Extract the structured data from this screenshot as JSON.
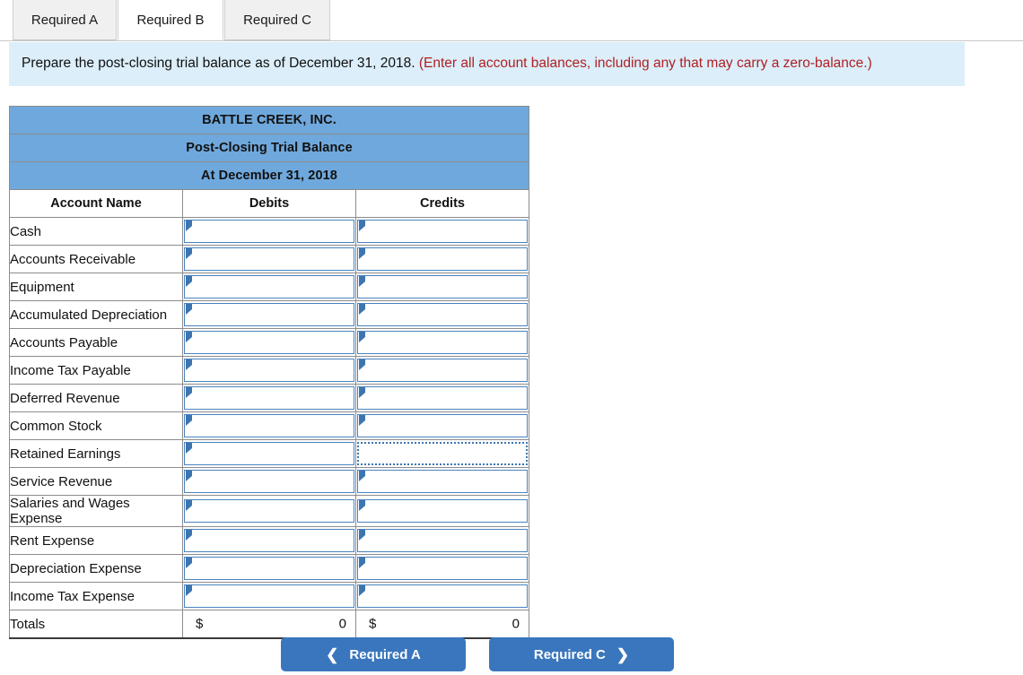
{
  "tabs": [
    {
      "label": "Required A",
      "active": false
    },
    {
      "label": "Required B",
      "active": true
    },
    {
      "label": "Required C",
      "active": false
    }
  ],
  "instruction": {
    "main": "Prepare the post-closing trial balance as of December 31, 2018.",
    "hint": "(Enter all account balances, including any that may carry a zero-balance.)"
  },
  "table": {
    "title_company": "BATTLE CREEK, INC.",
    "title_statement": "Post-Closing Trial Balance",
    "title_date": "At December 31, 2018",
    "columns": [
      "Account Name",
      "Debits",
      "Credits"
    ],
    "rows": [
      {
        "account": "Cash",
        "debit": "",
        "credit": ""
      },
      {
        "account": "Accounts Receivable",
        "debit": "",
        "credit": ""
      },
      {
        "account": "Equipment",
        "debit": "",
        "credit": ""
      },
      {
        "account": "Accumulated Depreciation",
        "debit": "",
        "credit": ""
      },
      {
        "account": "Accounts Payable",
        "debit": "",
        "credit": ""
      },
      {
        "account": "Income Tax Payable",
        "debit": "",
        "credit": ""
      },
      {
        "account": "Deferred Revenue",
        "debit": "",
        "credit": ""
      },
      {
        "account": "Common Stock",
        "debit": "",
        "credit": ""
      },
      {
        "account": "Retained Earnings",
        "debit": "",
        "credit": ""
      },
      {
        "account": "Service Revenue",
        "debit": "",
        "credit": ""
      },
      {
        "account": "Salaries and Wages Expense",
        "debit": "",
        "credit": ""
      },
      {
        "account": "Rent Expense",
        "debit": "",
        "credit": ""
      },
      {
        "account": "Depreciation Expense",
        "debit": "",
        "credit": ""
      },
      {
        "account": "Income Tax Expense",
        "debit": "",
        "credit": ""
      }
    ],
    "totals": {
      "label": "Totals",
      "debit_currency": "$",
      "debit_value": "0",
      "credit_currency": "$",
      "credit_value": "0"
    },
    "focused_cell": {
      "row": 8,
      "column": "credit"
    }
  },
  "nav": {
    "prev_label": "Required A",
    "prev_icon": "chevron-left-icon",
    "next_label": "Required C",
    "next_icon": "chevron-right-icon"
  },
  "colors": {
    "header_blue": "#6fa8dc",
    "banner_blue": "#dbeef9",
    "hint_red": "#b01f24",
    "button_blue": "#3a76bd",
    "input_border": "#4a83bf"
  }
}
